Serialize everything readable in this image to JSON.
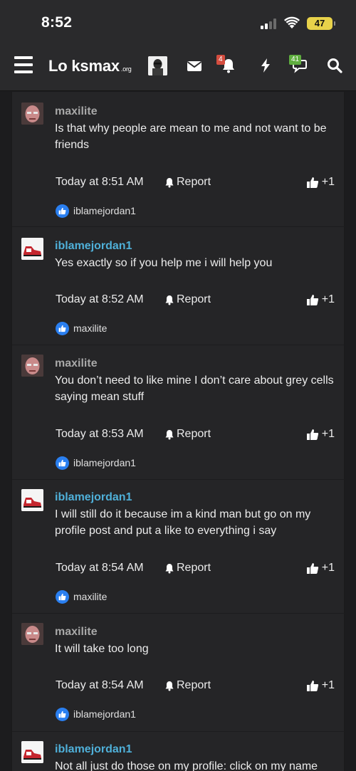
{
  "status_bar": {
    "time": "8:52",
    "battery": "47"
  },
  "navbar": {
    "logo": "Lo ksmax",
    "logo_suffix": ".org",
    "alerts_badge": "4",
    "conversations_badge": "41"
  },
  "posts": [
    {
      "username": "maxilite",
      "message": "Is that why people are mean to me and not want to be friends",
      "time": "Today at 8:51 AM",
      "report": "Report",
      "plus": "+1",
      "liker": "iblamejordan1"
    },
    {
      "username": "iblamejordan1",
      "message": "Yes exactly so if you help me i will help you",
      "time": "Today at 8:52 AM",
      "report": "Report",
      "plus": "+1",
      "liker": "maxilite"
    },
    {
      "username": "maxilite",
      "message": "You don’t need to like mine I don’t care about grey cells saying mean stuff",
      "time": "Today at 8:53 AM",
      "report": "Report",
      "plus": "+1",
      "liker": "iblamejordan1"
    },
    {
      "username": "iblamejordan1",
      "message": "I will still do it because im a kind man but go on my profile post and put a like to everything i say",
      "time": "Today at 8:54 AM",
      "report": "Report",
      "plus": "+1",
      "liker": "maxilite"
    },
    {
      "username": "maxilite",
      "message": "It will take too long",
      "time": "Today at 8:54 AM",
      "report": "Report",
      "plus": "+1",
      "liker": "iblamejordan1"
    },
    {
      "username": "iblamejordan1",
      "message": "Not all just do those on my profile: click on my name"
    }
  ]
}
